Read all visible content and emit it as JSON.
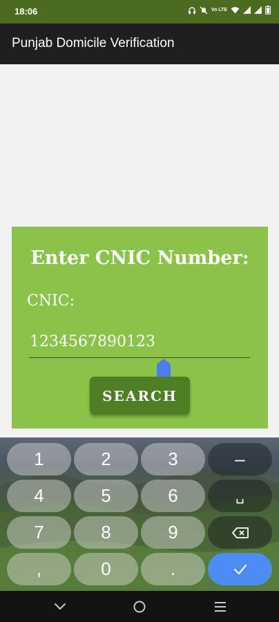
{
  "status_bar": {
    "time": "18:06",
    "network_label": "Vo LTE",
    "icons": [
      "headphones-icon",
      "mute-icon",
      "volte-icon",
      "wifi-icon",
      "signal-icon",
      "signal-icon",
      "battery-icon"
    ]
  },
  "app_bar": {
    "title": "Punjab Domicile Verification"
  },
  "form": {
    "heading": "Enter CNIC Number:",
    "cnic_label": "CNIC:",
    "cnic_value": "1234567890123",
    "search_label": "SEARCH"
  },
  "keyboard": {
    "keys": [
      "1",
      "2",
      "3",
      "–",
      "4",
      "5",
      "6",
      "␣",
      "7",
      "8",
      "9",
      "backspace",
      ",",
      "0",
      ".",
      "enter"
    ]
  },
  "colors": {
    "status_bar": "#4b6b1e",
    "app_bar": "#1f1f1f",
    "card": "#8bc34a",
    "button": "#4e7f24",
    "enter_key": "#4d8cf5",
    "cursor_handle": "#4d7cf0"
  },
  "nav_bar": {
    "icons": [
      "back-chevron-icon",
      "home-circle-icon",
      "recents-menu-icon"
    ]
  }
}
